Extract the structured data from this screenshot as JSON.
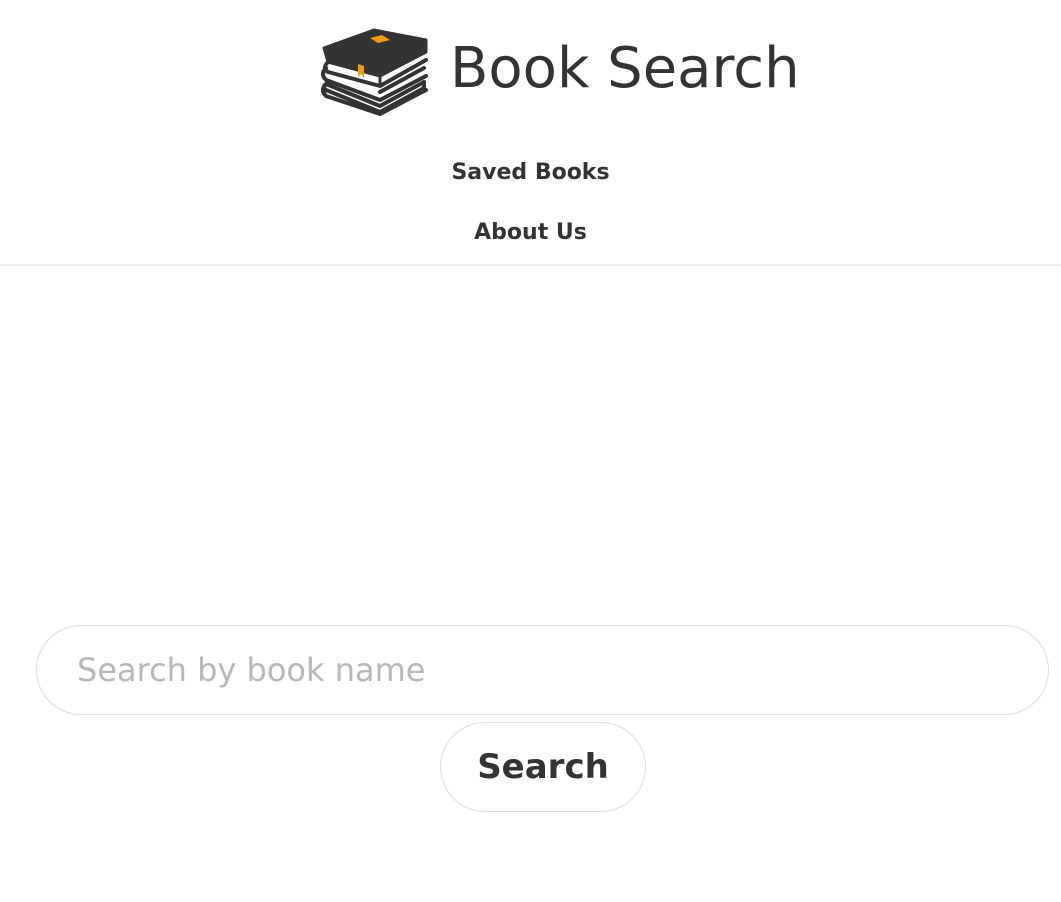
{
  "header": {
    "logo_icon": "books-stack-icon",
    "title": "Book Search",
    "accent_color": "#f39c12"
  },
  "nav": {
    "saved_books": "Saved Books",
    "about_us": "About Us"
  },
  "search": {
    "placeholder": "Search by book name",
    "value": "",
    "button_label": "Search"
  }
}
